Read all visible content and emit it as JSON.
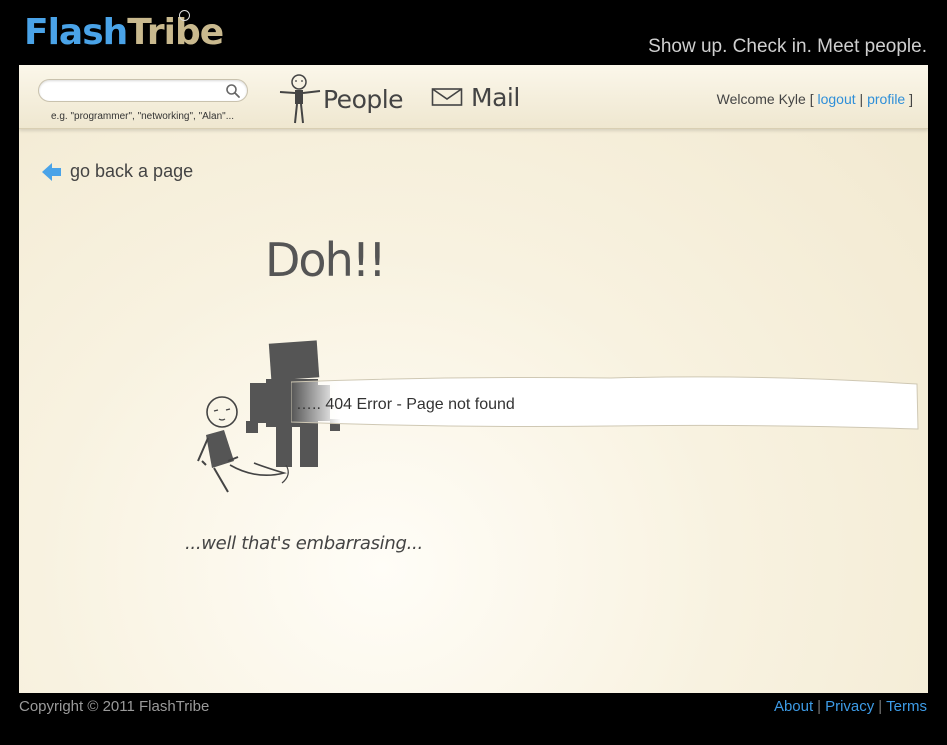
{
  "header": {
    "logo_part1": "Flash",
    "logo_part2": "Tribe",
    "tagline": "Show up. Check in. Meet people."
  },
  "nav": {
    "search": {
      "value": "",
      "placeholder": "",
      "hint": "e.g. \"programmer\", \"networking\", \"Alan\"..."
    },
    "people_label": "People",
    "mail_label": "Mail",
    "welcome_prefix": "Welcome Kyle [",
    "logout_label": "logout",
    "separator": "|",
    "profile_label": "profile",
    "welcome_suffix": "]"
  },
  "main": {
    "back_label": "go back a page",
    "heading": "Doh!!",
    "error_message": "….. 404 Error - Page not found",
    "caption": "...well that's embarrasing..."
  },
  "footer": {
    "copyright": "Copyright © 2011 FlashTribe",
    "links": [
      "About",
      "Privacy",
      "Terms"
    ],
    "separator": "|"
  },
  "colors": {
    "accent_blue": "#4aa3e8",
    "logo_tan": "#c9b98e",
    "link_blue": "#2f8fd8",
    "page_bg": "#000000",
    "panel_cream": "#f8f2e0"
  },
  "icons": {
    "search": "search-icon",
    "people": "stick-figure-icon",
    "mail": "envelope-icon",
    "back": "left-arrow-icon"
  }
}
